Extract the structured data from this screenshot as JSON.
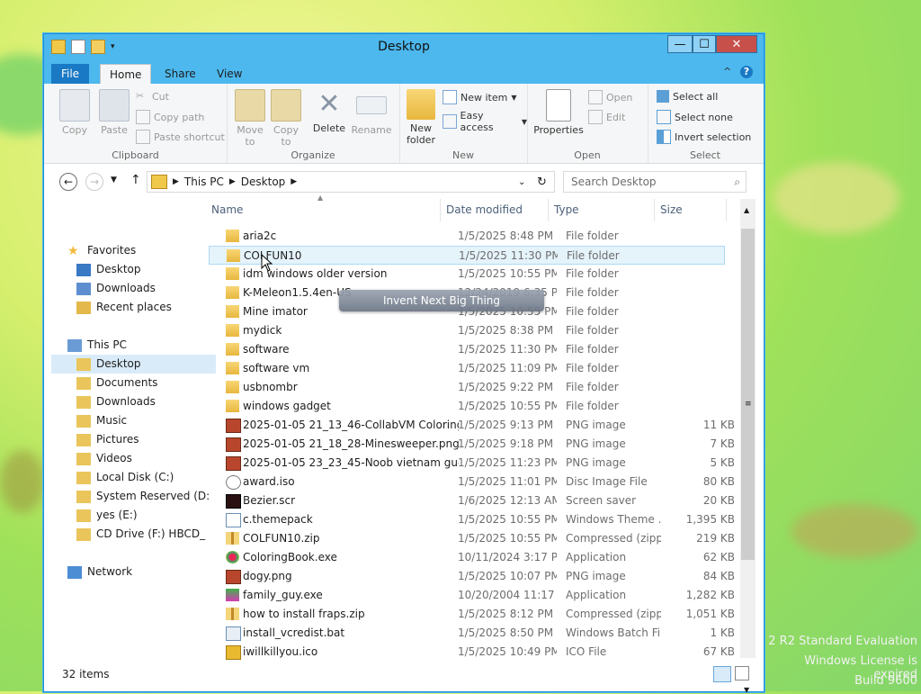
{
  "window": {
    "title": "Desktop",
    "min": "—",
    "max": "☐",
    "close": "✕"
  },
  "tabs": {
    "file": "File",
    "home": "Home",
    "share": "Share",
    "view": "View",
    "collapse": "^",
    "help": "?"
  },
  "ribbon": {
    "clipboard": {
      "label": "Clipboard",
      "copy": "Copy",
      "paste": "Paste",
      "cut": "Cut",
      "copy_path": "Copy path",
      "paste_shortcut": "Paste shortcut"
    },
    "organize": {
      "label": "Organize",
      "move_to": "Move to",
      "copy_to": "Copy to",
      "delete": "Delete",
      "rename": "Rename"
    },
    "new": {
      "label": "New",
      "new_folder": "New folder",
      "new_item": "New item",
      "easy_access": "Easy access"
    },
    "open": {
      "label": "Open",
      "properties": "Properties",
      "open": "Open",
      "edit": "Edit"
    },
    "select": {
      "label": "Select",
      "select_all": "Select all",
      "select_none": "Select none",
      "invert": "Invert selection"
    }
  },
  "address": {
    "crumb1": "This PC",
    "crumb2": "Desktop",
    "search_placeholder": "Search Desktop"
  },
  "nav": {
    "favorites": "Favorites",
    "fav_items": [
      "Desktop",
      "Downloads",
      "Recent places"
    ],
    "this_pc": "This PC",
    "pc_items": [
      "Desktop",
      "Documents",
      "Downloads",
      "Music",
      "Pictures",
      "Videos",
      "Local Disk (C:)",
      "System Reserved (D:",
      "yes (E:)",
      "CD Drive (F:) HBCD_"
    ],
    "network": "Network"
  },
  "columns": {
    "name": "Name",
    "date": "Date modified",
    "type": "Type",
    "size": "Size"
  },
  "files": [
    {
      "name": "aria2c",
      "date": "1/5/2025 8:48 PM",
      "type": "File folder",
      "size": "",
      "kind": "folder"
    },
    {
      "name": "COLFUN10",
      "date": "1/5/2025 11:30 PM",
      "type": "File folder",
      "size": "",
      "kind": "folder"
    },
    {
      "name": "idm windows older version",
      "date": "1/5/2025 10:55 PM",
      "type": "File folder",
      "size": "",
      "kind": "folder"
    },
    {
      "name": "K-Meleon1.5.4en-US",
      "date": "12/24/2019 6:35 PM",
      "type": "File folder",
      "size": "",
      "kind": "folder"
    },
    {
      "name": "Mine imator",
      "date": "1/5/2025 10:55 PM",
      "type": "File folder",
      "size": "",
      "kind": "folder"
    },
    {
      "name": "mydick",
      "date": "1/5/2025 8:38 PM",
      "type": "File folder",
      "size": "",
      "kind": "folder"
    },
    {
      "name": "software",
      "date": "1/5/2025 11:30 PM",
      "type": "File folder",
      "size": "",
      "kind": "folder"
    },
    {
      "name": "software vm",
      "date": "1/5/2025 11:09 PM",
      "type": "File folder",
      "size": "",
      "kind": "folder"
    },
    {
      "name": "usbnombr",
      "date": "1/5/2025 9:22 PM",
      "type": "File folder",
      "size": "",
      "kind": "folder"
    },
    {
      "name": "windows gadget",
      "date": "1/5/2025 10:55 PM",
      "type": "File folder",
      "size": "",
      "kind": "folder"
    },
    {
      "name": "2025-01-05 21_13_46-CollabVM Coloring ...",
      "date": "1/5/2025 9:13 PM",
      "type": "PNG image",
      "size": "11 KB",
      "kind": "png"
    },
    {
      "name": "2025-01-05 21_18_28-Minesweeper.png",
      "date": "1/5/2025 9:18 PM",
      "type": "PNG image",
      "size": "7 KB",
      "kind": "png"
    },
    {
      "name": "2025-01-05 23_23_45-Noob vietnam gues...",
      "date": "1/5/2025 11:23 PM",
      "type": "PNG image",
      "size": "5 KB",
      "kind": "png"
    },
    {
      "name": "award.iso",
      "date": "1/5/2025 11:01 PM",
      "type": "Disc Image File",
      "size": "80 KB",
      "kind": "iso"
    },
    {
      "name": "Bezier.scr",
      "date": "1/6/2025 12:13 AM",
      "type": "Screen saver",
      "size": "20 KB",
      "kind": "scr"
    },
    {
      "name": "c.themepack",
      "date": "1/5/2025 10:55 PM",
      "type": "Windows Theme ...",
      "size": "1,395 KB",
      "kind": "theme"
    },
    {
      "name": "COLFUN10.zip",
      "date": "1/5/2025 10:55 PM",
      "type": "Compressed (zipp...",
      "size": "219 KB",
      "kind": "zip"
    },
    {
      "name": "ColoringBook.exe",
      "date": "10/11/2024 3:17 PM",
      "type": "Application",
      "size": "62 KB",
      "kind": "exe"
    },
    {
      "name": "dogy.png",
      "date": "1/5/2025 10:07 PM",
      "type": "PNG image",
      "size": "84 KB",
      "kind": "png"
    },
    {
      "name": "family_guy.exe",
      "date": "10/20/2004 11:17 ...",
      "type": "Application",
      "size": "1,282 KB",
      "kind": "exe2"
    },
    {
      "name": "how to install fraps.zip",
      "date": "1/5/2025 8:12 PM",
      "type": "Compressed (zipp...",
      "size": "1,051 KB",
      "kind": "zip"
    },
    {
      "name": "install_vcredist.bat",
      "date": "1/5/2025 8:50 PM",
      "type": "Windows Batch File",
      "size": "1 KB",
      "kind": "bat"
    },
    {
      "name": "iwillkillyou.ico",
      "date": "1/5/2025 10:49 PM",
      "type": "ICO File",
      "size": "67 KB",
      "kind": "ico"
    }
  ],
  "status": {
    "count": "32 items"
  },
  "tooltip": "Invent Next Big Thing",
  "watermark": [
    "2 R2 Standard Evaluation",
    "Windows License is expired",
    "Build 9600"
  ],
  "colors": {
    "titlebar": "#4cb8ee",
    "file_tab": "#1979c4",
    "close": "#c7504b",
    "selection": "#e5f3fb"
  }
}
